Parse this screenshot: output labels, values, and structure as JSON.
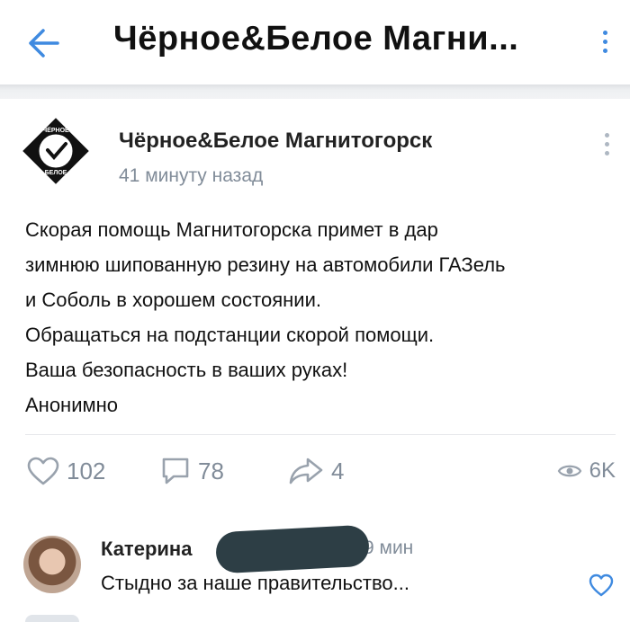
{
  "header": {
    "title": "Чёрное&Белое Магни..."
  },
  "post": {
    "group_name": "Чёрное&Белое Магнитогорск",
    "time": "41 минуту назад",
    "logo_text_top": "ЧЁРНОЕ",
    "logo_text_bottom": "БЕЛОЕ",
    "text_lines": [
      "Скорая помощь Магнитогорска примет в дар",
      "зимнюю шипованную резину на автомобили ГАЗель",
      "и Соболь в хорошем состоянии.",
      "Обращаться на подстанции скорой помощи.",
      "Ваша безопасность в ваших руках!",
      "Анонимно"
    ],
    "likes": "102",
    "comments": "78",
    "shares": "4",
    "views": "6K"
  },
  "comment": {
    "author": "Катерина",
    "time": "9 мин",
    "text": "Стыдно за наше правительство..."
  },
  "colors": {
    "accent": "#3f8ae0",
    "muted": "#818c99"
  }
}
